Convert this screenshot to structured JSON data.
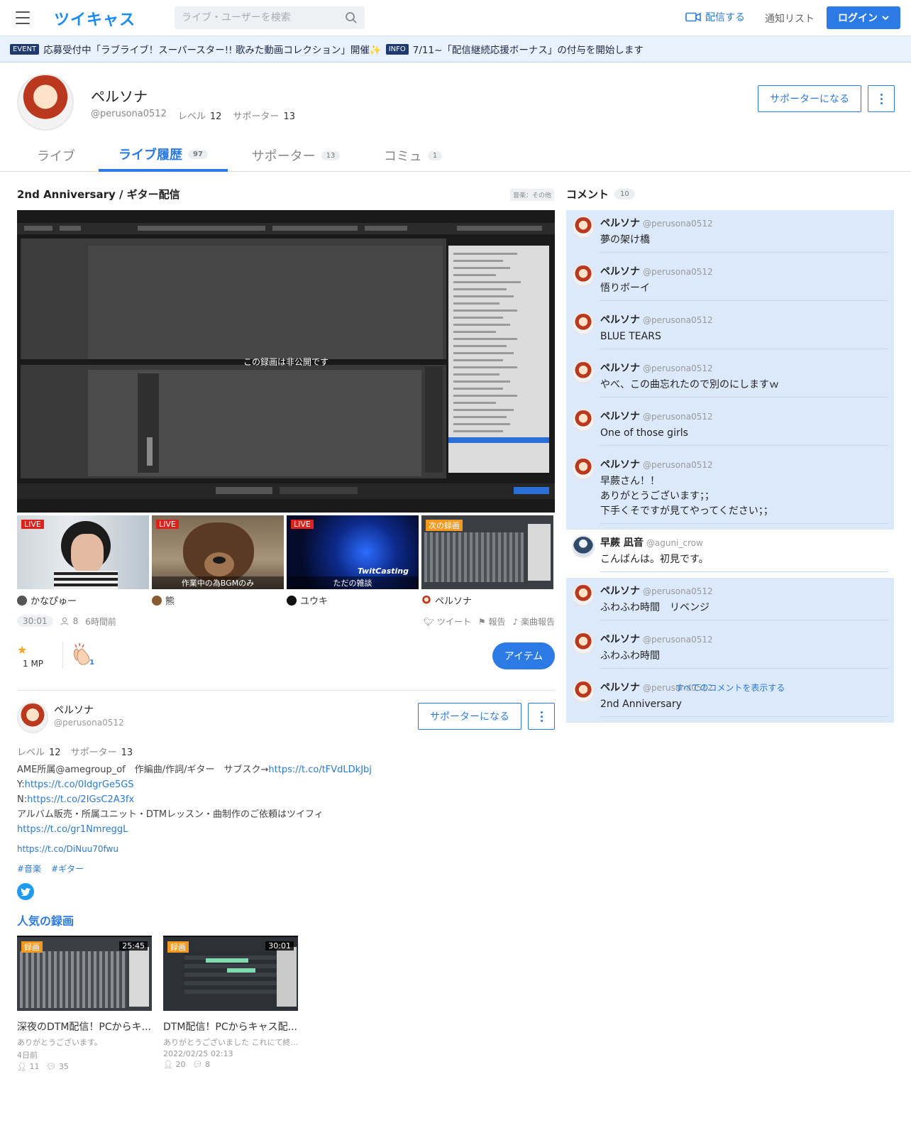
{
  "header": {
    "logo": "ツイキャス",
    "search_placeholder": "ライブ・ユーザーを検索",
    "broadcast_label": "配信する",
    "notify_label": "通知リスト",
    "login_label": "ログイン"
  },
  "notices": [
    {
      "badge": "EVENT",
      "text": "応募受付中「ラブライブ！スーパースター!! 歌みた動画コレクション」開催✨"
    },
    {
      "badge": "INFO",
      "text": "7/11~「配信継続応援ボーナス」の付与を開始します"
    }
  ],
  "profile": {
    "name": "ペルソナ",
    "handle": "@perusona0512",
    "level_label": "レベル",
    "level": "12",
    "supporter_label": "サポーター",
    "supporters": "13",
    "become_supporter": "サポーターになる"
  },
  "tabs": [
    {
      "label": "ライブ",
      "count": ""
    },
    {
      "label": "ライブ履歴",
      "count": "97"
    },
    {
      "label": "サポーター",
      "count": "13"
    },
    {
      "label": "コミュ",
      "count": "1"
    }
  ],
  "live": {
    "title": "2nd Anniversary / ギター配信",
    "genre": "音楽：その他",
    "private_message": "この録画は非公開です",
    "duration": "30:01",
    "viewers": "8",
    "time_ago": "6時間前",
    "tweet_label": "ツイート",
    "report_label": "報告",
    "song_report_label": "楽曲報告",
    "mp": "1 MP",
    "clap_count": "1",
    "item_button": "アイテム"
  },
  "related": [
    {
      "tag": "LIVE",
      "caption": "",
      "user": "かなぴゅー"
    },
    {
      "tag": "LIVE",
      "caption": "作業中の為BGMのみ",
      "user": "熊"
    },
    {
      "tag": "LIVE",
      "caption": "ただの雑談",
      "user": "ユウキ",
      "watermark": "TwitCasting"
    },
    {
      "tag": "次の録画",
      "caption": "",
      "user": "ペルソナ"
    }
  ],
  "owner": {
    "name": "ペルソナ",
    "handle": "@perusona0512",
    "level_label": "レベル",
    "level": "12",
    "supporter_label": "サポーター",
    "supporters": "13",
    "become_supporter": "サポーターになる",
    "bio_line1_text": "AME所属@amegroup_of　作編曲/作詞/ギター　サブスク→",
    "bio_line1_link": "https://t.co/tFVdLDkJbj",
    "bio_line2_prefix": "Y:",
    "bio_line2_link": "https://t.co/0IdgrGe5GS",
    "bio_line3_prefix": "N:",
    "bio_line3_link": "https://t.co/2IGsC2A3fx",
    "bio_line4_text": "アルバム販売・所属ユニット・DTMレッスン・曲制作のご依頼はツイフィ",
    "bio_line5_link": "https://t.co/gr1NmreggL",
    "extra_link": "https://t.co/DiNuu70fwu",
    "hashtags": [
      "#音楽",
      "#ギター"
    ]
  },
  "popular": {
    "title": "人気の録画",
    "items": [
      {
        "tag": "録画",
        "duration": "25:45",
        "title": "深夜のDTM配信！PCからキ...",
        "subtitle": "ありがとうございます。",
        "date": "4日前",
        "viewers": "11",
        "comments": "35"
      },
      {
        "tag": "録画",
        "duration": "30:01",
        "title": "DTM配信！PCからキャス配...",
        "subtitle": "ありがとうございました これにて終...",
        "date": "2022/02/25 02:13",
        "viewers": "20",
        "comments": "8"
      }
    ]
  },
  "comments": {
    "title": "コメント",
    "count": "10",
    "items": [
      {
        "name": "ペルソナ",
        "id": "@perusona0512",
        "lines": [
          "夢の架け橋"
        ],
        "highlight": true
      },
      {
        "name": "ペルソナ",
        "id": "@perusona0512",
        "lines": [
          "悟りボーイ"
        ],
        "highlight": true
      },
      {
        "name": "ペルソナ",
        "id": "@perusona0512",
        "lines": [
          "BLUE TEARS"
        ],
        "highlight": true
      },
      {
        "name": "ペルソナ",
        "id": "@perusona0512",
        "lines": [
          "やべ、この曲忘れたので別のにしますｗ"
        ],
        "highlight": true
      },
      {
        "name": "ペルソナ",
        "id": "@perusona0512",
        "lines": [
          "One of those girls"
        ],
        "highlight": true
      },
      {
        "name": "ペルソナ",
        "id": "@perusona0512",
        "lines": [
          "早蕨さん！！",
          "ありがとうございます；；",
          "下手くそですが見てやってください；；"
        ],
        "highlight": true
      },
      {
        "name": "早蕨 凪音",
        "id": "@aguni_crow",
        "lines": [
          "こんばんは。初見です。"
        ],
        "highlight": false
      },
      {
        "name": "ペルソナ",
        "id": "@perusona0512",
        "lines": [
          "ふわふわ時間　リベンジ"
        ],
        "highlight": true
      },
      {
        "name": "ペルソナ",
        "id": "@perusona0512",
        "lines": [
          "ふわふわ時間"
        ],
        "highlight": true
      },
      {
        "name": "ペルソナ",
        "id": "@perusona0512",
        "lines": [
          "2nd Anniversary"
        ],
        "highlight": true
      }
    ],
    "show_all": "すべてのコメントを表示する"
  }
}
